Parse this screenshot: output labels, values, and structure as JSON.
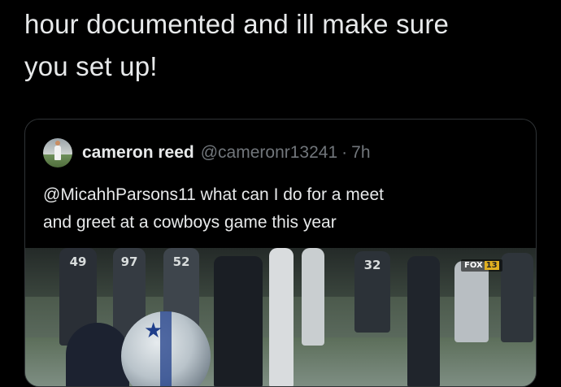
{
  "tweet": {
    "lines": [
      "hour documented and ill make sure",
      "you set up!"
    ]
  },
  "quote": {
    "display_name": "cameron reed",
    "handle": "@cameronr13241",
    "separator": "·",
    "time": "7h",
    "lines": [
      "@MicahhParsons11 what can I do for a meet",
      "and greet at a cowboys game this year"
    ],
    "media": {
      "jersey_numbers": [
        "49",
        "97",
        "52",
        "32"
      ],
      "network_logo": "FOX",
      "network_channel": "13"
    }
  },
  "colors": {
    "background": "#000000",
    "text": "#e7e9ea",
    "secondary_text": "#71767b",
    "border": "#2f3336",
    "helmet_blue": "#1f3e8a"
  }
}
